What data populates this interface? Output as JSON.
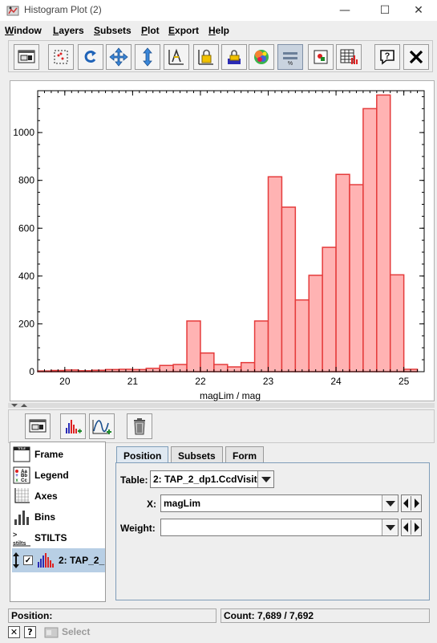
{
  "window": {
    "title": "Histogram Plot (2)"
  },
  "menu": [
    {
      "label": "Window",
      "mnemonic": "W",
      "rest": "indow"
    },
    {
      "label": "Layers",
      "mnemonic": "L",
      "rest": "ayers"
    },
    {
      "label": "Subsets",
      "mnemonic": "S",
      "rest": "ubsets"
    },
    {
      "label": "Plot",
      "mnemonic": "P",
      "rest": "lot"
    },
    {
      "label": "Export",
      "mnemonic": "E",
      "rest": "xport"
    },
    {
      "label": "Help",
      "mnemonic": "H",
      "rest": "elp"
    }
  ],
  "toolbar_icons": [
    "window-control-icon",
    "select-region-icon",
    "redo-replot-icon",
    "pan-move-icon",
    "vertical-zoom-icon",
    "axis-lock-icon",
    "scale-lock-icon",
    "stack-icon",
    "aux-color-icon",
    "bar-height-icon",
    "export-image-icon",
    "table-view-icon",
    "help-icon",
    "close-icon"
  ],
  "chart_data": {
    "type": "bar",
    "xlabel": "magLim / mag",
    "ylabel": "",
    "xlim": [
      19.6,
      25.3
    ],
    "ylim": [
      0,
      1175
    ],
    "x_ticks": [
      "20",
      "21",
      "22",
      "23",
      "24",
      "25"
    ],
    "y_ticks": [
      "0",
      "200",
      "400",
      "600",
      "800",
      "1000"
    ],
    "bin_width": 0.2,
    "bins": [
      {
        "x0": 19.6,
        "value": 3
      },
      {
        "x0": 19.8,
        "value": 5
      },
      {
        "x0": 20.0,
        "value": 7
      },
      {
        "x0": 20.2,
        "value": 4
      },
      {
        "x0": 20.4,
        "value": 6
      },
      {
        "x0": 20.6,
        "value": 9
      },
      {
        "x0": 20.8,
        "value": 10
      },
      {
        "x0": 21.0,
        "value": 9
      },
      {
        "x0": 21.2,
        "value": 14
      },
      {
        "x0": 21.4,
        "value": 26
      },
      {
        "x0": 21.6,
        "value": 30
      },
      {
        "x0": 21.8,
        "value": 212
      },
      {
        "x0": 22.0,
        "value": 78
      },
      {
        "x0": 22.2,
        "value": 30
      },
      {
        "x0": 22.4,
        "value": 20
      },
      {
        "x0": 22.6,
        "value": 38
      },
      {
        "x0": 22.8,
        "value": 212
      },
      {
        "x0": 23.0,
        "value": 815
      },
      {
        "x0": 23.2,
        "value": 688
      },
      {
        "x0": 23.4,
        "value": 300
      },
      {
        "x0": 23.6,
        "value": 403
      },
      {
        "x0": 23.8,
        "value": 520
      },
      {
        "x0": 24.0,
        "value": 825
      },
      {
        "x0": 24.2,
        "value": 782
      },
      {
        "x0": 24.4,
        "value": 1100
      },
      {
        "x0": 24.6,
        "value": 1157
      },
      {
        "x0": 24.8,
        "value": 405
      },
      {
        "x0": 25.0,
        "value": 10
      }
    ],
    "colors": {
      "fill": "#ffb3b3",
      "stroke": "#e53b3b"
    },
    "grid": false
  },
  "lower_toolbar_icons": [
    "floating-window-icon",
    "add-histogram-layer-icon",
    "add-kde-layer-icon",
    "delete-layer-icon"
  ],
  "controls": [
    {
      "label": "Frame",
      "icon": "frame-title-icon"
    },
    {
      "label": "Legend",
      "icon": "legend-icon"
    },
    {
      "label": "Axes",
      "icon": "axes-icon"
    },
    {
      "label": "Bins",
      "icon": "bins-icon"
    },
    {
      "label": "STILTS",
      "icon": "stilts-icon"
    },
    {
      "label": "2: TAP_2_",
      "icon": "histogram-layer-icon",
      "selected": true,
      "checked": true
    }
  ],
  "tabs": [
    "Position",
    "Subsets",
    "Form"
  ],
  "active_tab": "Position",
  "position": {
    "table_label": "Table:",
    "table_value": "2: TAP_2_dp1.CcdVisit",
    "x_label": "X:",
    "x_value": "magLim",
    "weight_label": "Weight:",
    "weight_value": ""
  },
  "status": {
    "position_label": "Position:",
    "count_text": "Count: 7,689 / 7,692"
  },
  "bottom": {
    "select_label": "Select",
    "help_glyph": "?"
  }
}
